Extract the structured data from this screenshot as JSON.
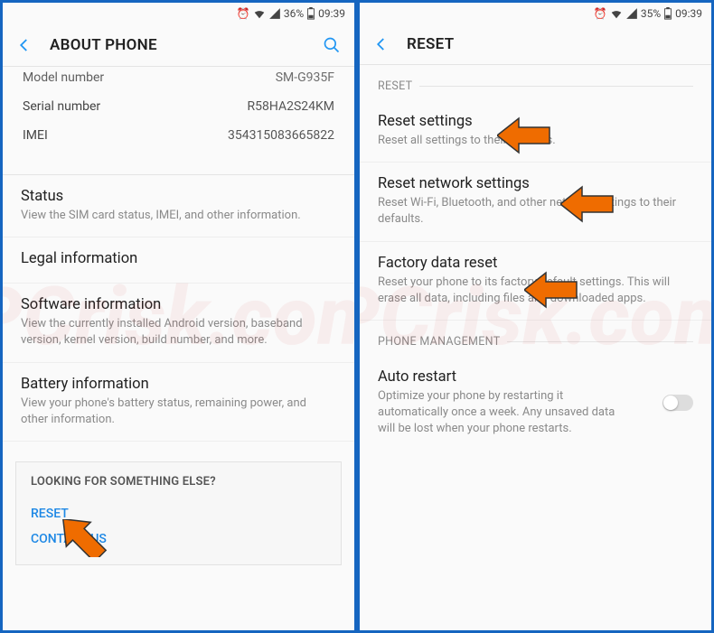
{
  "left": {
    "status": {
      "battery_pct": "36%",
      "time": "09:39"
    },
    "header": {
      "title": "ABOUT PHONE"
    },
    "info_rows": [
      {
        "label": "Model number",
        "value": "SM-G935F"
      },
      {
        "label": "Serial number",
        "value": "R58HA2S24KM"
      },
      {
        "label": "IMEI",
        "value": "354315083665822"
      }
    ],
    "items": [
      {
        "title": "Status",
        "desc": "View the SIM card status, IMEI, and other information."
      },
      {
        "title": "Legal information",
        "desc": ""
      },
      {
        "title": "Software information",
        "desc": "View the currently installed Android version, baseband version, kernel version, build number, and more."
      },
      {
        "title": "Battery information",
        "desc": "View your phone's battery status, remaining power, and other information."
      }
    ],
    "footer": {
      "title": "LOOKING FOR SOMETHING ELSE?",
      "links": [
        "RESET",
        "CONTACT US"
      ]
    }
  },
  "right": {
    "status": {
      "battery_pct": "35%",
      "time": "09:39"
    },
    "header": {
      "title": "RESET"
    },
    "sections": [
      {
        "label": "RESET",
        "items": [
          {
            "title": "Reset settings",
            "desc": "Reset all settings to their defaults."
          },
          {
            "title": "Reset network settings",
            "desc": "Reset Wi-Fi, Bluetooth, and other network settings to their defaults."
          },
          {
            "title": "Factory data reset",
            "desc": "Reset your phone to its factory default settings. This will erase all data, including files and downloaded apps."
          }
        ]
      },
      {
        "label": "PHONE MANAGEMENT",
        "items": [
          {
            "title": "Auto restart",
            "desc": "Optimize your phone by restarting it automatically once a week. Any unsaved data will be lost when your phone restarts.",
            "toggle": false
          }
        ]
      }
    ]
  },
  "watermark": "PCrisk.com"
}
